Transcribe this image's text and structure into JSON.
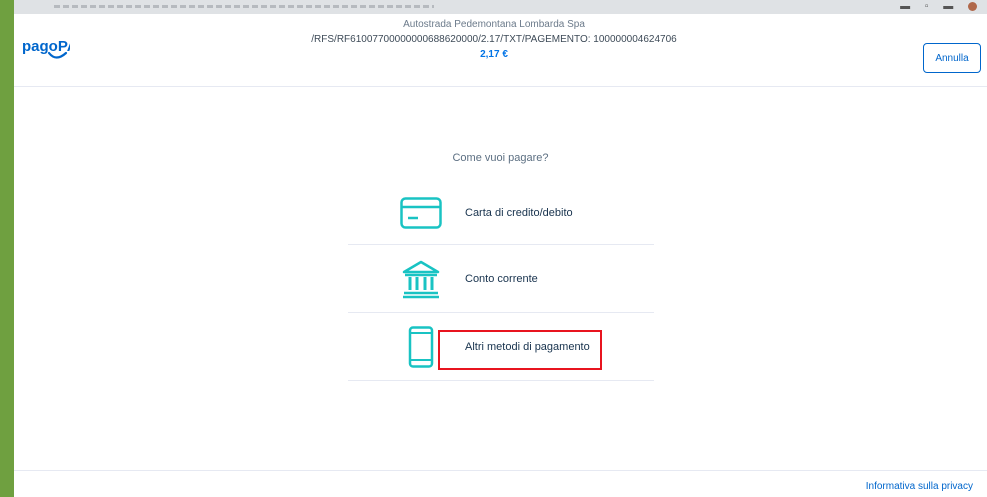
{
  "header": {
    "company": "Autostrada Pedemontana Lombarda Spa",
    "reference": "/RFS/RF61007700000000688620000/2.17/TXT/PAGEMENTO: 100000004624706",
    "amount": "2,17 €",
    "cancel_label": "Annulla",
    "logo_text": "pagoPA"
  },
  "main": {
    "question": "Come vuoi pagare?",
    "methods": [
      {
        "label": "Carta di credito/debito",
        "icon": "credit-card-icon"
      },
      {
        "label": "Conto corrente",
        "icon": "bank-icon"
      },
      {
        "label": "Altri metodi di pagamento",
        "icon": "smartphone-icon"
      }
    ]
  },
  "footer": {
    "privacy_label": "Informativa sulla privacy"
  },
  "colors": {
    "accent": "#0066cc",
    "icon": "#19c3c3",
    "highlight": "#e8141f",
    "frame": "#6fa040"
  }
}
